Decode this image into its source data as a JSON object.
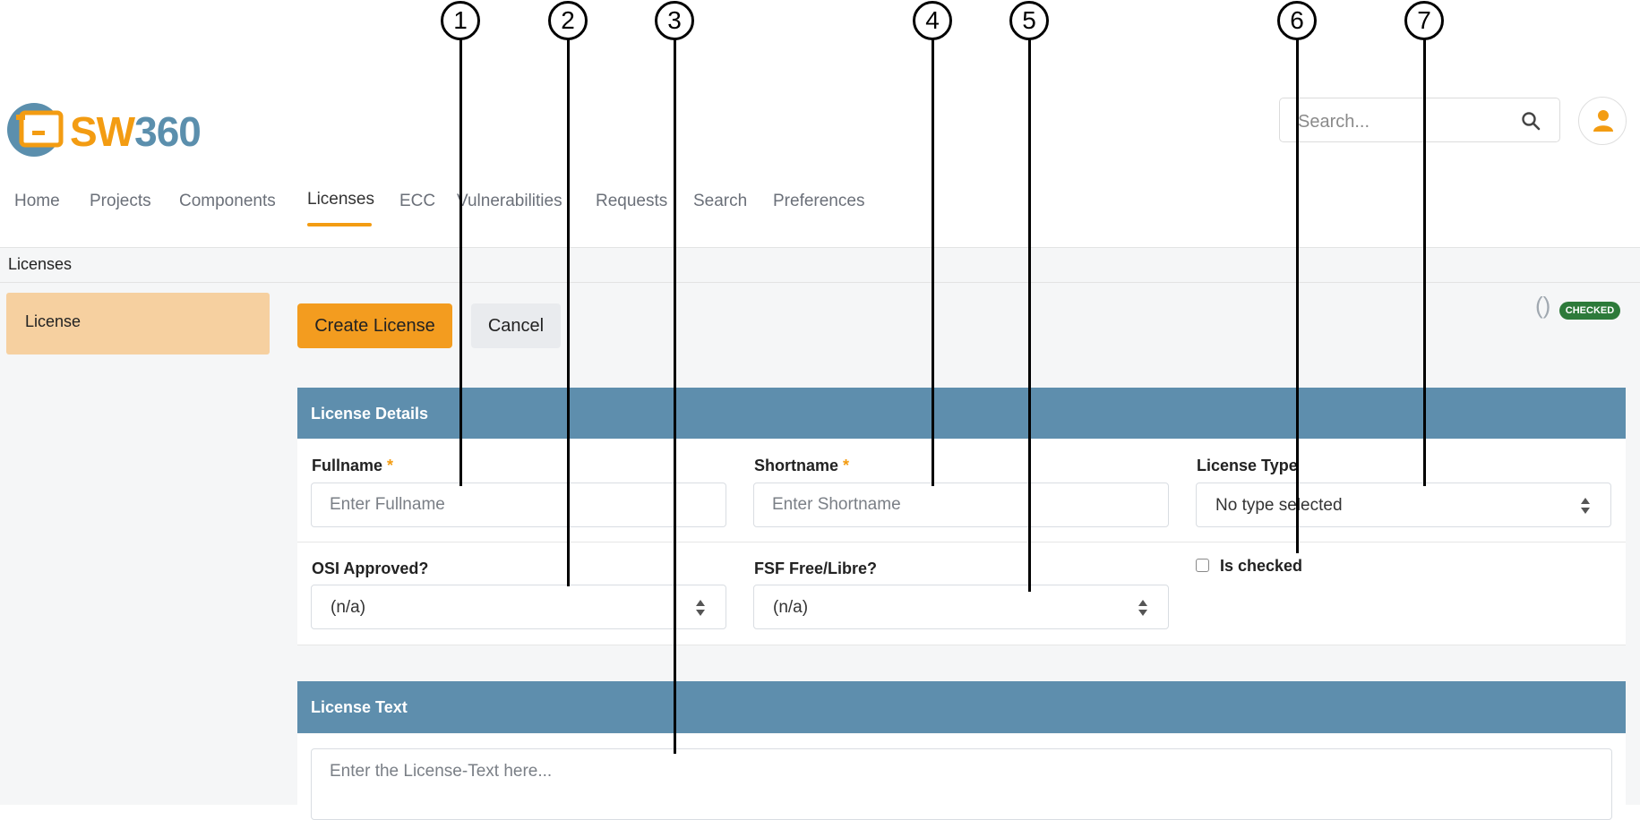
{
  "app": {
    "logo_text_a": "SW",
    "logo_text_b": "360"
  },
  "header": {
    "search": {
      "placeholder": "Search..."
    },
    "search_icon": "magnifier-icon",
    "avatar_icon": "user-icon"
  },
  "nav": {
    "items": [
      {
        "label": "Home"
      },
      {
        "label": "Projects"
      },
      {
        "label": "Components"
      },
      {
        "label": "Licenses",
        "active": true
      },
      {
        "label": "ECC"
      },
      {
        "label": "Vulnerabilities"
      },
      {
        "label": "Requests"
      },
      {
        "label": "Search"
      },
      {
        "label": "Preferences"
      }
    ]
  },
  "breadcrumb": {
    "text": "Licenses"
  },
  "sidebar": {
    "item_label": "License"
  },
  "toolbar": {
    "create_label": "Create License",
    "cancel_label": "Cancel",
    "paren": "()",
    "checked_badge": "CHECKED"
  },
  "details": {
    "title": "License Details",
    "fullname": {
      "label": "Fullname",
      "required_mark": "*",
      "placeholder": "Enter Fullname"
    },
    "shortname": {
      "label": "Shortname",
      "required_mark": "*",
      "placeholder": "Enter Shortname"
    },
    "license_type": {
      "label": "License Type",
      "value": "No type selected"
    },
    "osi_approved": {
      "label": "OSI Approved?",
      "value": "(n/a)"
    },
    "fsf_free": {
      "label": "FSF Free/Libre?",
      "value": "(n/a)"
    },
    "is_checked": {
      "label": "Is checked",
      "checked": false
    }
  },
  "license_text": {
    "title": "License Text",
    "placeholder": "Enter the License-Text here..."
  },
  "callouts": [
    "1",
    "2",
    "3",
    "4",
    "5",
    "6",
    "7"
  ],
  "colors": {
    "accent": "#f39c12",
    "section_header": "#5e8ead",
    "sidebar_active": "#f6d0a0",
    "badge_green": "#2d7a3a"
  }
}
